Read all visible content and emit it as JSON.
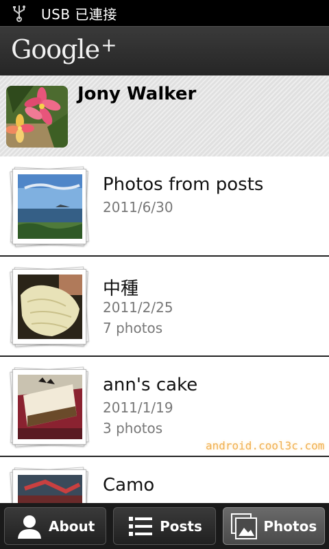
{
  "status_bar": {
    "text": "USB 已連接"
  },
  "app": {
    "logo": "Google",
    "logo_plus": "+"
  },
  "profile": {
    "name": "Jony Walker"
  },
  "albums": [
    {
      "title": "Photos from posts",
      "date": "2011/6/30",
      "count": ""
    },
    {
      "title": "中種",
      "date": "2011/2/25",
      "count": "7 photos"
    },
    {
      "title": "ann's cake",
      "date": "2011/1/19",
      "count": "3 photos"
    },
    {
      "title": "Camo",
      "date": "",
      "count": ""
    }
  ],
  "watermark": "android.cool3c.com",
  "tabs": [
    {
      "label": "About",
      "icon": "person-icon",
      "active": false
    },
    {
      "label": "Posts",
      "icon": "list-icon",
      "active": false
    },
    {
      "label": "Photos",
      "icon": "photos-icon",
      "active": true
    }
  ]
}
